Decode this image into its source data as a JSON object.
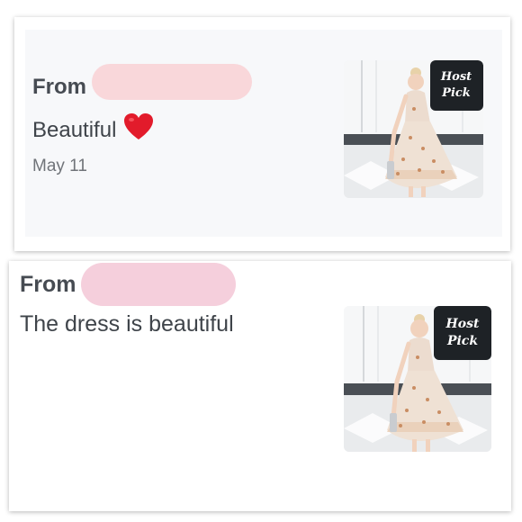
{
  "colors": {
    "redaction": "#f9d7da",
    "redaction_2": "#f5cfdc",
    "heart": "#e21b2b",
    "badge_bg": "#1e2226"
  },
  "comments": [
    {
      "from_label": "From",
      "message": "Beautiful",
      "emoji": "red-heart",
      "date": "May 11",
      "badge": {
        "line1": "Host",
        "line2": "Pick"
      }
    },
    {
      "from_label": "From",
      "message": "The dress is beautiful",
      "badge": {
        "line1": "Host",
        "line2": "Pick"
      }
    }
  ]
}
